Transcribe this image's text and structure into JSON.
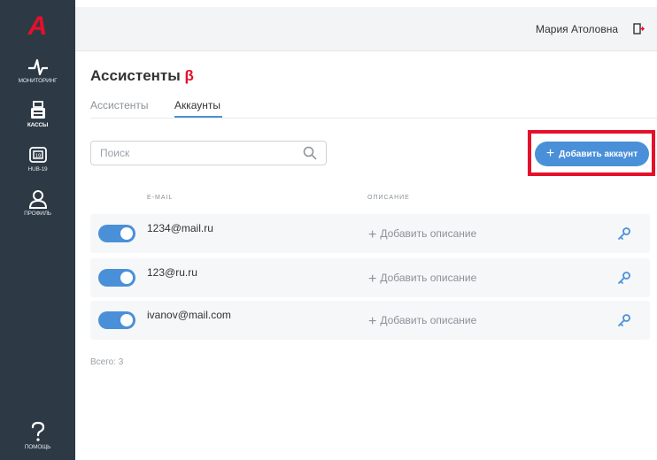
{
  "app": {
    "logo_letter": "A"
  },
  "sidebar": {
    "items": [
      {
        "label": "МОНИТОРИНГ",
        "icon": "pulse-icon"
      },
      {
        "label": "КАССЫ",
        "icon": "cash-register-icon"
      },
      {
        "label": "HUB-19",
        "icon": "hub-device-icon"
      },
      {
        "label": "ПРОФИЛЬ",
        "icon": "user-icon"
      },
      {
        "label": "ПОМОЩЬ",
        "icon": "question-icon"
      }
    ]
  },
  "header": {
    "user_name": "Мария Атоловна",
    "logout_icon": "logout-icon"
  },
  "page": {
    "title": "Ассистенты",
    "beta": "β",
    "tabs": [
      {
        "label": "Ассистенты"
      },
      {
        "label": "Аккаунты",
        "active": true
      }
    ]
  },
  "search": {
    "placeholder": "Поиск",
    "value": ""
  },
  "add_button": {
    "plus": "+",
    "label": "Добавить аккаунт",
    "color": "#4a90d9"
  },
  "table": {
    "columns": [
      "E-MAIL",
      "ОПИСАНИЕ"
    ],
    "rows": [
      {
        "email": "1234@mail.ru",
        "description_action": "Добавить описание",
        "enabled": true
      },
      {
        "email": "123@ru.ru",
        "description_action": "Добавить описание",
        "enabled": true
      },
      {
        "email": "ivanov@mail.com",
        "description_action": "Добавить описание",
        "enabled": true
      }
    ]
  },
  "footer": {
    "total": "Всего: 3"
  },
  "colors": {
    "accent": "#4a90d9",
    "brand_red": "#e5102a",
    "sidebar": "#2d3a45"
  }
}
